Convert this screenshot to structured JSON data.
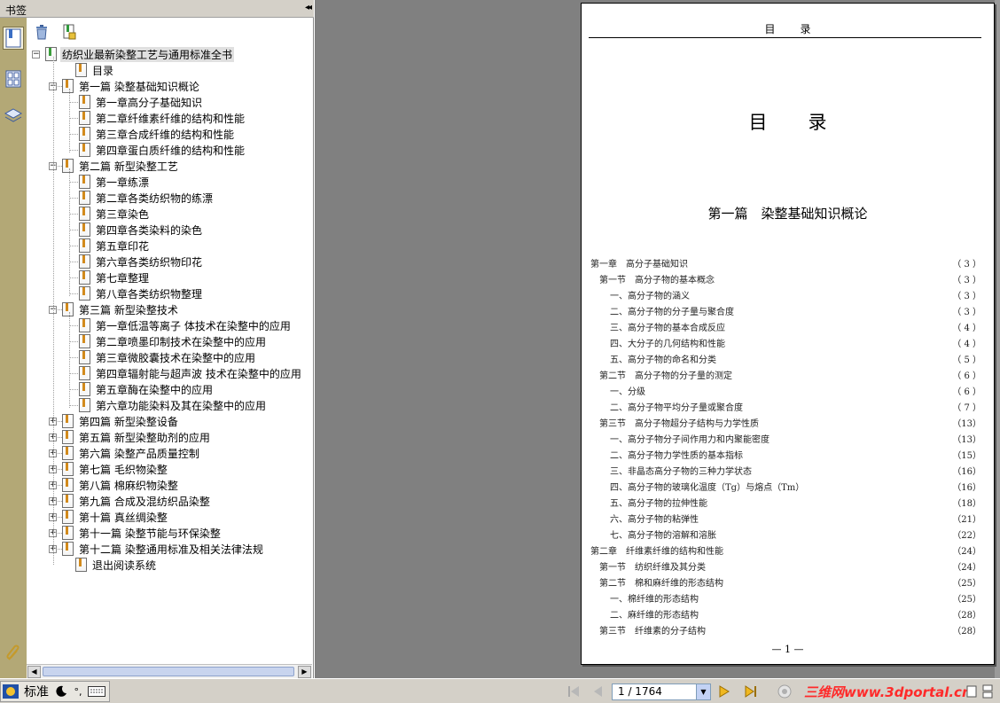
{
  "bookmark_pane": {
    "title": "书签",
    "collapse_glyph": "◂◂",
    "toolbar": {
      "delete_icon": "trash-icon",
      "new_icon": "new-bookmark-icon"
    },
    "rail_icons": [
      "bookmarks-icon",
      "thumbnails-icon",
      "layers-icon",
      "attachments-icon"
    ]
  },
  "bookmarks": {
    "root": "纺织业最新染整工艺与通用标准全书",
    "contents": "目录",
    "parts": [
      {
        "label": "第一篇 染整基础知识概论",
        "expanded": true,
        "chapters": [
          "第一章高分子基础知识",
          "第二章纤维素纤维的结构和性能",
          "第三章合成纤维的结构和性能",
          "第四章蛋白质纤维的结构和性能"
        ]
      },
      {
        "label": "第二篇 新型染整工艺",
        "expanded": true,
        "chapters": [
          "第一章练漂",
          "第二章各类纺织物的练漂",
          "第三章染色",
          "第四章各类染料的染色",
          "第五章印花",
          "第六章各类纺织物印花",
          "第七章整理",
          "第八章各类纺织物整理"
        ]
      },
      {
        "label": "第三篇 新型染整技术",
        "expanded": true,
        "chapters": [
          "第一章低温等离子  体技术在染整中的应用",
          "第二章喷墨印制技术在染整中的应用",
          "第三章微胶囊技术在染整中的应用",
          "第四章辐射能与超声波  技术在染整中的应用",
          "第五章酶在染整中的应用",
          "第六章功能染料及其在染整中的应用"
        ]
      },
      {
        "label": "第四篇 新型染整设备",
        "expanded": false,
        "chapters": []
      },
      {
        "label": "第五篇 新型染整助剂的应用",
        "expanded": false,
        "chapters": []
      },
      {
        "label": "第六篇 染整产品质量控制",
        "expanded": false,
        "chapters": []
      },
      {
        "label": "第七篇 毛织物染整",
        "expanded": false,
        "chapters": []
      },
      {
        "label": "第八篇 棉麻织物染整",
        "expanded": false,
        "chapters": []
      },
      {
        "label": "第九篇 合成及混纺织品染整",
        "expanded": false,
        "chapters": []
      },
      {
        "label": "第十篇 真丝绸染整",
        "expanded": false,
        "chapters": []
      },
      {
        "label": "第十一篇 染整节能与环保染整",
        "expanded": false,
        "chapters": []
      },
      {
        "label": "第十二篇 染整通用标准及相关法律法规",
        "expanded": false,
        "chapters": []
      }
    ],
    "exit": "退出阅读系统"
  },
  "document": {
    "running_head": "目录",
    "big_title": "目录",
    "part_title": "第一篇　染整基础知识概论",
    "page_number": "— 1 —",
    "toc": [
      {
        "text": "第一章　高分子基础知识",
        "page": "（ 3 ）",
        "level": 0
      },
      {
        "text": "第一节　高分子物的基本概念",
        "page": "（ 3 ）",
        "level": 1
      },
      {
        "text": "一、高分子物的涵义",
        "page": "（ 3 ）",
        "level": 2
      },
      {
        "text": "二、高分子物的分子量与聚合度",
        "page": "（ 3 ）",
        "level": 2
      },
      {
        "text": "三、高分子物的基本合成反应",
        "page": "（ 4 ）",
        "level": 2
      },
      {
        "text": "四、大分子的几何结构和性能",
        "page": "（ 4 ）",
        "level": 2
      },
      {
        "text": "五、高分子物的命名和分类",
        "page": "（ 5 ）",
        "level": 2
      },
      {
        "text": "第二节　高分子物的分子量的测定",
        "page": "（ 6 ）",
        "level": 1
      },
      {
        "text": "一、分级",
        "page": "（ 6 ）",
        "level": 2
      },
      {
        "text": "二、高分子物平均分子量或聚合度",
        "page": "（ 7 ）",
        "level": 2
      },
      {
        "text": "第三节　高分子物超分子结构与力学性质",
        "page": "（13）",
        "level": 1
      },
      {
        "text": "一、高分子物分子间作用力和内聚能密度",
        "page": "（13）",
        "level": 2
      },
      {
        "text": "二、高分子物力学性质的基本指标",
        "page": "（15）",
        "level": 2
      },
      {
        "text": "三、非晶态高分子物的三种力学状态",
        "page": "（16）",
        "level": 2
      },
      {
        "text": "四、高分子物的玻璃化温度（Tg）与熔点（Tm）",
        "page": "（16）",
        "level": 2
      },
      {
        "text": "五、高分子物的拉伸性能",
        "page": "（18）",
        "level": 2
      },
      {
        "text": "六、高分子物的粘弹性",
        "page": "（21）",
        "level": 2
      },
      {
        "text": "七、高分子物的溶解和溶胀",
        "page": "（22）",
        "level": 2
      },
      {
        "text": "第二章　纤维素纤维的结构和性能",
        "page": "（24）",
        "level": 0
      },
      {
        "text": "第一节　纺织纤维及其分类",
        "page": "（24）",
        "level": 1
      },
      {
        "text": "第二节　棉和麻纤维的形态结构",
        "page": "（25）",
        "level": 1
      },
      {
        "text": "一、棉纤维的形态结构",
        "page": "（25）",
        "level": 2
      },
      {
        "text": "二、麻纤维的形态结构",
        "page": "（28）",
        "level": 2
      },
      {
        "text": "第三节　纤维素的分子结构",
        "page": "（28）",
        "level": 1
      }
    ]
  },
  "statusbar": {
    "ime_mode": "标准",
    "page_field": "1 / 1764",
    "watermark": "三维网www.3dportal.cn",
    "nav_icons": [
      "first-page-icon",
      "prev-page-icon",
      "next-page-icon",
      "last-page-icon"
    ]
  }
}
